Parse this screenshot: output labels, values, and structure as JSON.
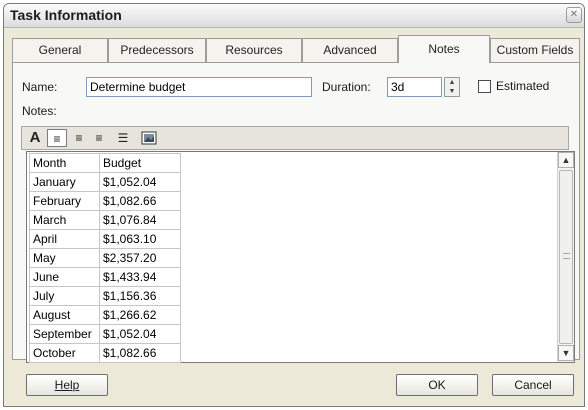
{
  "window": {
    "title": "Task Information"
  },
  "tabs": [
    {
      "label": "General"
    },
    {
      "label": "Predecessors"
    },
    {
      "label": "Resources"
    },
    {
      "label": "Advanced"
    },
    {
      "label": "Notes",
      "active": true
    },
    {
      "label": "Custom Fields"
    }
  ],
  "fields": {
    "name_label": "Name:",
    "name_value": "Determine budget",
    "duration_label": "Duration:",
    "duration_value": "3d",
    "estimated_label": "Estimated",
    "estimated_checked": false,
    "notes_label": "Notes:"
  },
  "toolbar": {
    "buttons": [
      "font",
      "align-left",
      "align-center",
      "align-right",
      "bullets",
      "insert-object"
    ],
    "pressed": "align-left"
  },
  "notes_table": {
    "header": [
      "Month",
      "Budget"
    ],
    "rows": [
      [
        "January",
        "$1,052.04"
      ],
      [
        "February",
        "$1,082.66"
      ],
      [
        "March",
        "$1,076.84"
      ],
      [
        "April",
        "$1,063.10"
      ],
      [
        "May",
        "$2,357.20"
      ],
      [
        "June",
        "$1,433.94"
      ],
      [
        "July",
        "$1,156.36"
      ],
      [
        "August",
        "$1,266.62"
      ],
      [
        "September",
        "$1,052.04"
      ],
      [
        "October",
        "$1,082.66"
      ]
    ]
  },
  "buttons": {
    "help": "Help",
    "ok": "OK",
    "cancel": "Cancel"
  }
}
